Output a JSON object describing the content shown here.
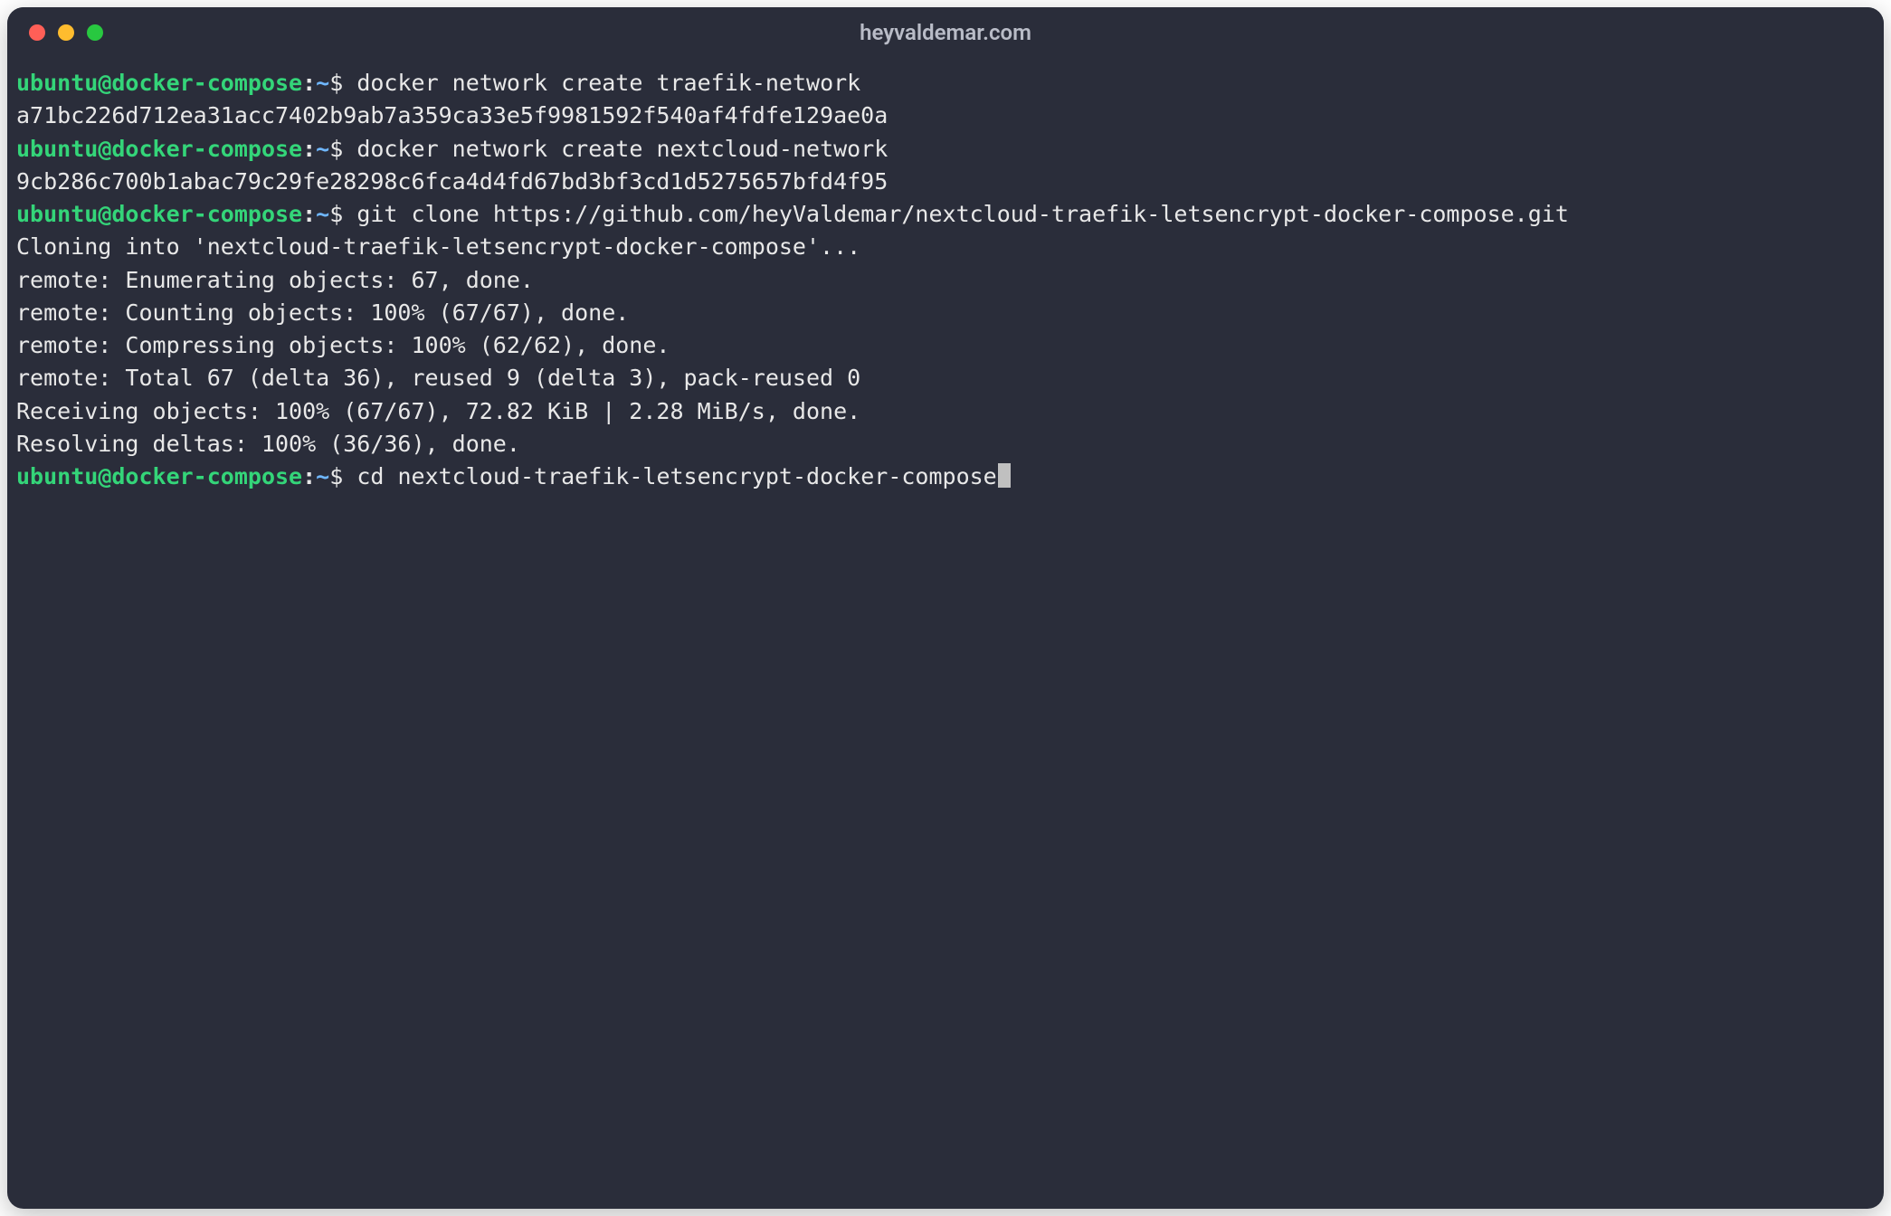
{
  "titlebar": {
    "title": "heyvaldemar.com",
    "buttons": {
      "close": "close",
      "minimize": "minimize",
      "zoom": "zoom"
    }
  },
  "prompt": {
    "user": "ubuntu",
    "at": "@",
    "host": "docker-compose",
    "colon": ":",
    "path": "~",
    "dollar": "$ "
  },
  "lines": [
    {
      "type": "prompt",
      "cmd": "docker network create traefik-network"
    },
    {
      "type": "output",
      "text": "a71bc226d712ea31acc7402b9ab7a359ca33e5f9981592f540af4fdfe129ae0a"
    },
    {
      "type": "prompt",
      "cmd": "docker network create nextcloud-network"
    },
    {
      "type": "output",
      "text": "9cb286c700b1abac79c29fe28298c6fca4d4fd67bd3bf3cd1d5275657bfd4f95"
    },
    {
      "type": "prompt",
      "cmd": "git clone https://github.com/heyValdemar/nextcloud-traefik-letsencrypt-docker-compose.git"
    },
    {
      "type": "output",
      "text": "Cloning into 'nextcloud-traefik-letsencrypt-docker-compose'..."
    },
    {
      "type": "output",
      "text": "remote: Enumerating objects: 67, done."
    },
    {
      "type": "output",
      "text": "remote: Counting objects: 100% (67/67), done."
    },
    {
      "type": "output",
      "text": "remote: Compressing objects: 100% (62/62), done."
    },
    {
      "type": "output",
      "text": "remote: Total 67 (delta 36), reused 9 (delta 3), pack-reused 0"
    },
    {
      "type": "output",
      "text": "Receiving objects: 100% (67/67), 72.82 KiB | 2.28 MiB/s, done."
    },
    {
      "type": "output",
      "text": "Resolving deltas: 100% (36/36), done."
    },
    {
      "type": "prompt",
      "cmd": "cd nextcloud-traefik-letsencrypt-docker-compose",
      "cursor": true
    }
  ]
}
